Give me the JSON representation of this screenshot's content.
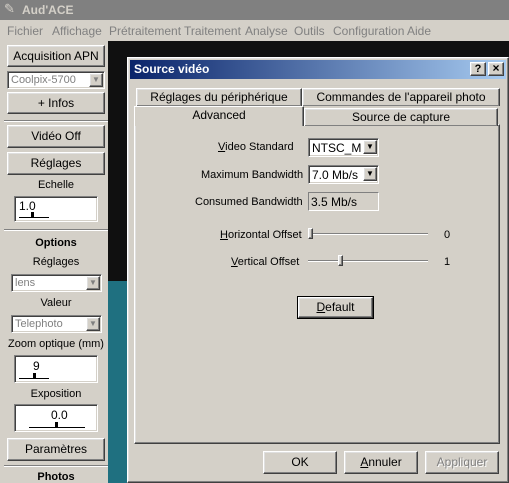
{
  "app": {
    "title": "Aud'ACE"
  },
  "menu": [
    "Fichier",
    "Affichage",
    "Prétraitement",
    "Traitement",
    "Analyse",
    "Outils",
    "Configuration",
    "Aide"
  ],
  "left_panel": {
    "acquisition_button": "Acquisition APN",
    "camera_select": "Coolpix-5700",
    "infos_button": "+ Infos",
    "video_off_button": "Vidéo Off",
    "reglages_button": "Réglages",
    "echelle_label": "Echelle",
    "echelle_value": "1.0",
    "options_heading": "Options",
    "reglages_label": "Réglages",
    "reglages_select": "lens",
    "valeur_label": "Valeur",
    "valeur_select": "Telephoto",
    "zoom_label": "Zoom optique (mm)",
    "zoom_value": "9",
    "exposition_label": "Exposition",
    "exposition_value": "0.0",
    "parametres_button": "Paramètres",
    "photos_heading": "Photos"
  },
  "dialog": {
    "title": "Source vidéo",
    "help_button": "?",
    "close_button": "×",
    "tabs_back": [
      "Réglages du périphérique",
      "Commandes de l'appareil photo"
    ],
    "tabs_front": [
      "Advanced",
      "Source de capture"
    ],
    "video_standard_label": "Video Standard",
    "video_standard_value": "NTSC_M",
    "max_bandwidth_label": "Maximum Bandwidth",
    "max_bandwidth_value": "7.0 Mb/s",
    "consumed_bandwidth_label": "Consumed Bandwidth",
    "consumed_bandwidth_value": "3.5 Mb/s",
    "h_offset_label": "Horizontal Offset",
    "h_offset_value": "0",
    "v_offset_label": "Vertical Offset",
    "v_offset_value": "1",
    "default_button": "Default",
    "ok_button": "OK",
    "cancel_button": "Annuler",
    "apply_button": "Appliquer"
  },
  "colors": {
    "title_bar": "#808080",
    "dialog_title": "#0a246a",
    "workspace": "#1f7080",
    "face": "#d4d0c8"
  }
}
